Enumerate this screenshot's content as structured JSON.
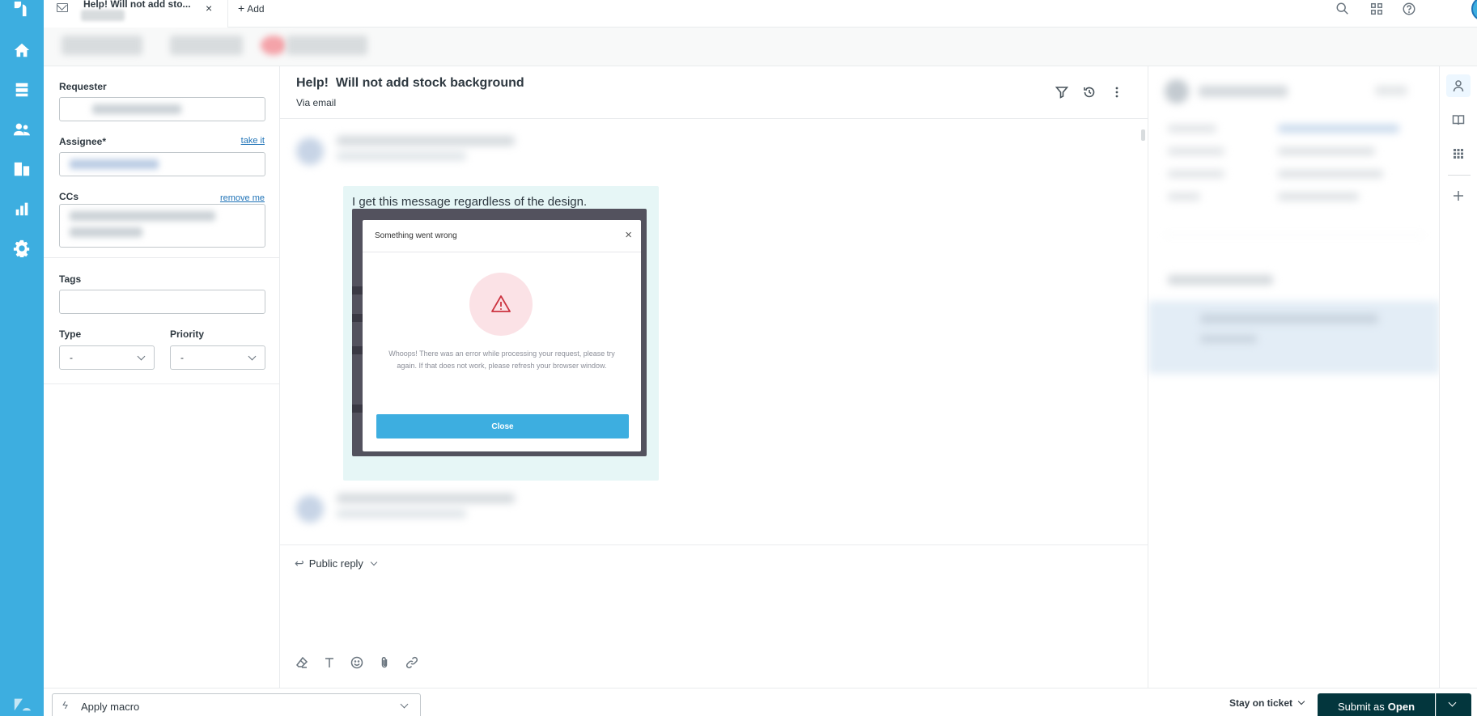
{
  "tab": {
    "title": "Help! Will not add sto...",
    "close": "×",
    "add_label": "Add"
  },
  "properties": {
    "requester_label": "Requester",
    "assignee_label": "Assignee*",
    "take_it": "take it",
    "ccs_label": "CCs",
    "remove_me": "remove me",
    "tags_label": "Tags",
    "type_label": "Type",
    "type_value": "-",
    "priority_label": "Priority",
    "priority_value": "-"
  },
  "ticket": {
    "title": "Help!  Will not add stock background",
    "via": "Via email",
    "message_text": "I get this message regardless of the design.",
    "attachment": {
      "dialog_title": "Something went wrong",
      "close_x": "×",
      "message": "Whoops! There was an error while processing your request, please try again. If that does not work, please refresh your browser window.",
      "button": "Close"
    }
  },
  "reply": {
    "channel": "Public reply"
  },
  "bottom": {
    "macro_label": "Apply macro",
    "stay_label": "Stay on ticket",
    "submit_prefix": "Submit as",
    "submit_status": "Open"
  },
  "colors": {
    "nav": "#3daee0",
    "primary_dark": "#03363d",
    "link": "#1f73b7",
    "bubble": "#e6f6f6"
  }
}
